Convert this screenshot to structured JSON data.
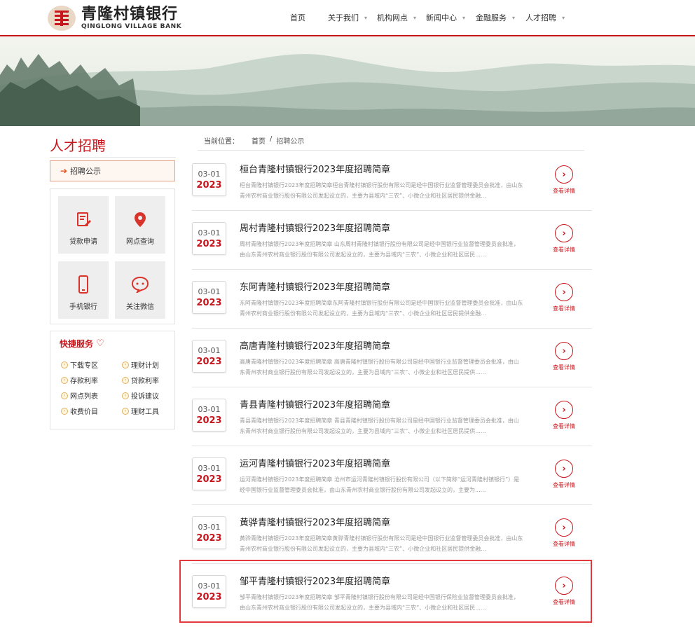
{
  "header": {
    "logo_cn": "青隆村镇银行",
    "logo_en": "QINGLONG VILLAGE BANK",
    "nav": [
      {
        "label": "首页",
        "has_caret": false
      },
      {
        "label": "关于我们",
        "has_caret": true
      },
      {
        "label": "机构网点",
        "has_caret": true
      },
      {
        "label": "新闻中心",
        "has_caret": true
      },
      {
        "label": "金融服务",
        "has_caret": true
      },
      {
        "label": "人才招聘",
        "has_caret": true
      }
    ]
  },
  "sidebar": {
    "title": "人才招聘",
    "active_item": "招聘公示",
    "tiles": [
      {
        "label": "贷款申请",
        "icon": "document-edit-icon"
      },
      {
        "label": "网点查询",
        "icon": "location-pin-icon"
      },
      {
        "label": "手机银行",
        "icon": "mobile-phone-icon"
      },
      {
        "label": "关注微信",
        "icon": "chat-bubble-icon"
      }
    ],
    "quick_title": "快捷服务",
    "quick_items": [
      "下载专区",
      "理财计划",
      "存款利率",
      "贷款利率",
      "网点列表",
      "投诉建议",
      "收费价目",
      "理财工具"
    ]
  },
  "breadcrumb": {
    "label": "当前位置：",
    "home": "首页",
    "separator": "/",
    "current": "招聘公示"
  },
  "list": {
    "detail_label": "查看详情",
    "items": [
      {
        "md": "03-01",
        "year": "2023",
        "title": "桓台青隆村镇银行2023年度招聘简章",
        "desc": "桓台青隆村镇银行2023年度招聘简章桓台青隆村镇银行股份有限公司是经中国银行业监督管理委员会批准，由山东青州农村商业银行股份有限公司发起设立的，主要为县域内“三农”、小微企业和社区居民提供金融..."
      },
      {
        "md": "03-01",
        "year": "2023",
        "title": "周村青隆村镇银行2023年度招聘简章",
        "desc": "周村青隆村镇银行2023年度招聘简章 山东周村青隆村镇银行股份有限公司是经中国银行业监督管理委员会批准，由山东青州农村商业银行股份有限公司发起设立的，主要为县域内“三农”、小微企业和社区居民......"
      },
      {
        "md": "03-01",
        "year": "2023",
        "title": "东阿青隆村镇银行2023年度招聘简章",
        "desc": "东阿青隆村镇银行2023年度招聘简章东阿青隆村镇银行股份有限公司是经中国银行业监督管理委员会批准，由山东青州农村商业银行股份有限公司发起设立的，主要为县域内“三农”、小微企业和社区居民提供金融..."
      },
      {
        "md": "03-01",
        "year": "2023",
        "title": "高唐青隆村镇银行2023年度招聘简章",
        "desc": "高唐青隆村镇银行2023年度招聘简章 高唐青隆村镇银行股份有限公司是经中国银行业监督管理委员会批准，由山东青州农村商业银行股份有限公司发起设立的，主要为县域内“三农”、小微企业和社区居民提供......"
      },
      {
        "md": "03-01",
        "year": "2023",
        "title": "青县青隆村镇银行2023年度招聘简章",
        "desc": "青县青隆村镇银行2023年度招聘简章 青县青隆村镇银行股份有限公司是经中国银行业监督管理委员会批准，由山东青州农村商业银行股份有限公司发起设立的，主要为县域内“三农”、小微企业和社区居民提供......"
      },
      {
        "md": "03-01",
        "year": "2023",
        "title": "运河青隆村镇银行2023年度招聘简章",
        "desc": "运河青隆村镇银行2023年度招聘简章 沧州市运河青隆村镇银行股份有限公司（以下简称“运河青隆村镇银行”）是经中国银行业监督管理委员会批准，由山东青州农村商业银行股份有限公司发起设立的，主要为......"
      },
      {
        "md": "03-01",
        "year": "2023",
        "title": "黄骅青隆村镇银行2023年度招聘简章",
        "desc": "黄骅青隆村镇银行2023年度招聘简章黄骅青隆村镇银行股份有限公司是经中国银行业监督管理委员会批准，由山东青州农村商业银行股份有限公司发起设立的，主要为县域内“三农”、小微企业和社区居民提供金融..."
      },
      {
        "md": "03-01",
        "year": "2023",
        "title": "邹平青隆村镇银行2023年度招聘简章",
        "desc": "邹平青隆村镇银行2023年度招聘简章 邹平青隆村镇银行股份有限公司是经中国银行保险业监督管理委员会批准，由山东青州农村商业银行股份有限公司发起设立的，主要为县域内“三农”、小微企业和社区居民......"
      }
    ]
  },
  "colors": {
    "brand_red": "#c8161d",
    "highlight_border": "#e0393e"
  }
}
